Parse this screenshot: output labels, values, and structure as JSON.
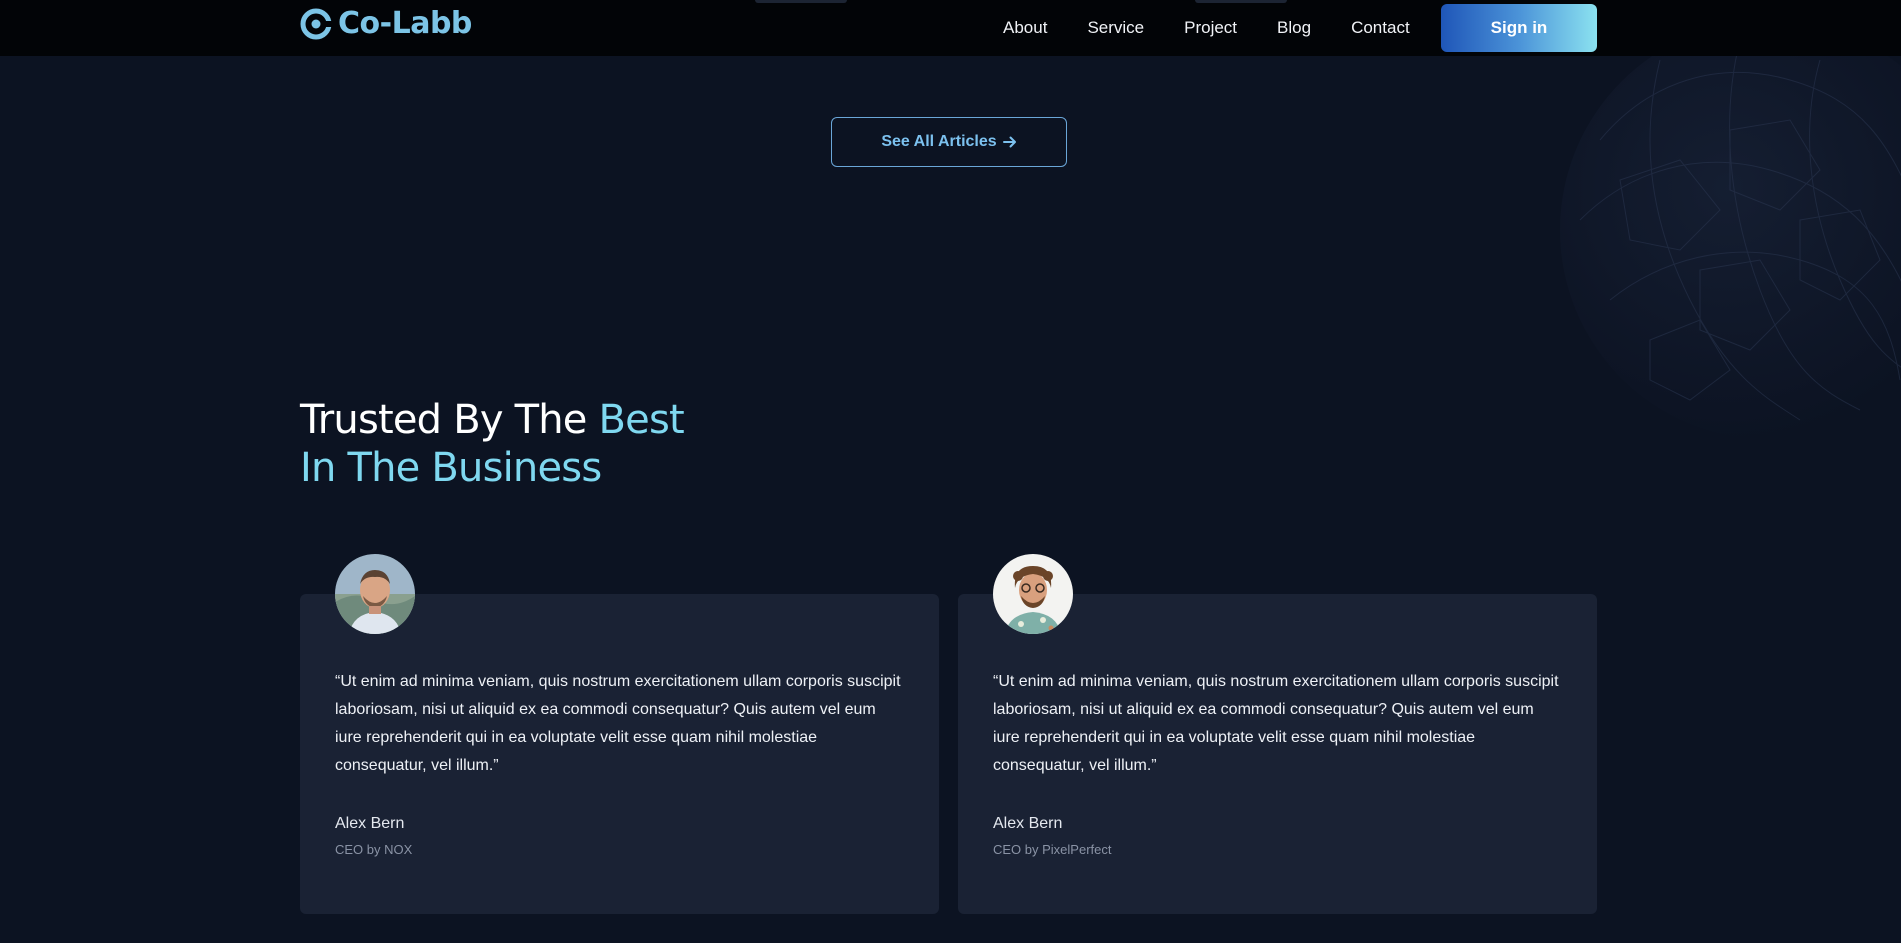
{
  "brand": {
    "name": "Co-Labb",
    "logo_icon": "c-ring-logo-icon",
    "accent_color": "#7cc4e6"
  },
  "nav": {
    "links": [
      "About",
      "Service",
      "Project",
      "Blog",
      "Contact"
    ],
    "signin_label": "Sign in"
  },
  "articles": {
    "see_all_label": "See All Articles",
    "see_all_icon": "arrow-right-icon"
  },
  "testimonials": {
    "title_part1": "Trusted By The ",
    "title_part2": "Best",
    "title_line2": "In The Business",
    "accent_color": "#7fd8f0",
    "items": [
      {
        "quote": "“Ut enim ad minima veniam, quis nostrum exercitationem ullam corporis suscipit laboriosam, nisi ut aliquid ex ea commodi consequatur? Quis autem vel eum iure reprehenderit qui in ea voluptate velit esse quam nihil molestiae consequatur, vel illum.”",
        "name": "Alex Bern",
        "role": "CEO by NOX",
        "avatar": "avatar-photo"
      },
      {
        "quote": "“Ut enim ad minima veniam, quis nostrum exercitationem ullam corporis suscipit laboriosam, nisi ut aliquid ex ea commodi consequatur? Quis autem vel eum iure reprehenderit qui in ea voluptate velit esse quam nihil molestiae consequatur, vel illum.”",
        "name": "Alex Bern",
        "role": "CEO by PixelPerfect",
        "avatar": "avatar-photo"
      }
    ]
  }
}
